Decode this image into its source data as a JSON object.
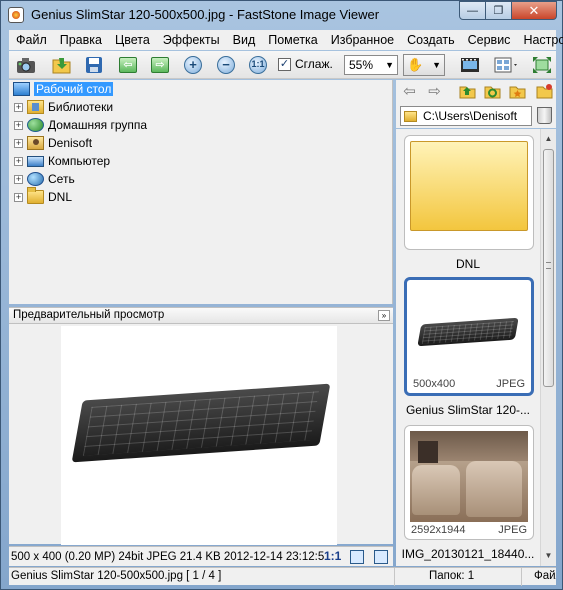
{
  "window": {
    "title": "Genius SlimStar 120-500x500.jpg  -  FastStone Image Viewer",
    "minimize_label": "—",
    "maximize_label": "❐",
    "close_label": "✕"
  },
  "menu": {
    "items": [
      "Файл",
      "Правка",
      "Цвета",
      "Эффекты",
      "Вид",
      "Пометка",
      "Избранное",
      "Создать",
      "Сервис",
      "Настройки"
    ]
  },
  "toolbar": {
    "smooth_label": "Сглаж.",
    "smooth_checked": "✓",
    "zoom_value": "55%",
    "zoom_arrow": "▼",
    "hand_arrow": "▼"
  },
  "tree": {
    "root": "Рабочий стол",
    "items": [
      "Библиотеки",
      "Домашняя группа",
      "Denisoft",
      "Компьютер",
      "Сеть",
      "DNL"
    ],
    "expand_glyph": "+"
  },
  "preview": {
    "title": "Предварительный просмотр",
    "collapse_glyph": "»"
  },
  "image_info": {
    "text": "500 x 400 (0.20 MP)  24bit  JPEG   21.4 KB   2012-12-14 23:12:5",
    "ratio": "1:1"
  },
  "browser": {
    "path": "C:\\Users\\Denisoft",
    "thumbnails": [
      {
        "caption": "DNL",
        "dims": "",
        "format": ""
      },
      {
        "caption": "Genius SlimStar 120-...",
        "dims": "500x400",
        "format": "JPEG"
      },
      {
        "caption": "IMG_20130121_18440...",
        "dims": "2592x1944",
        "format": "JPEG"
      }
    ]
  },
  "status": {
    "file": "Genius SlimStar 120-500x500.jpg [ 1 / 4 ]",
    "folders": "Папок: 1",
    "files": "Файл"
  },
  "colors": {
    "selection": "#3399ff",
    "thumb_selected_border": "#3a6db5",
    "title_gradient_top": "#a9c4e0"
  }
}
